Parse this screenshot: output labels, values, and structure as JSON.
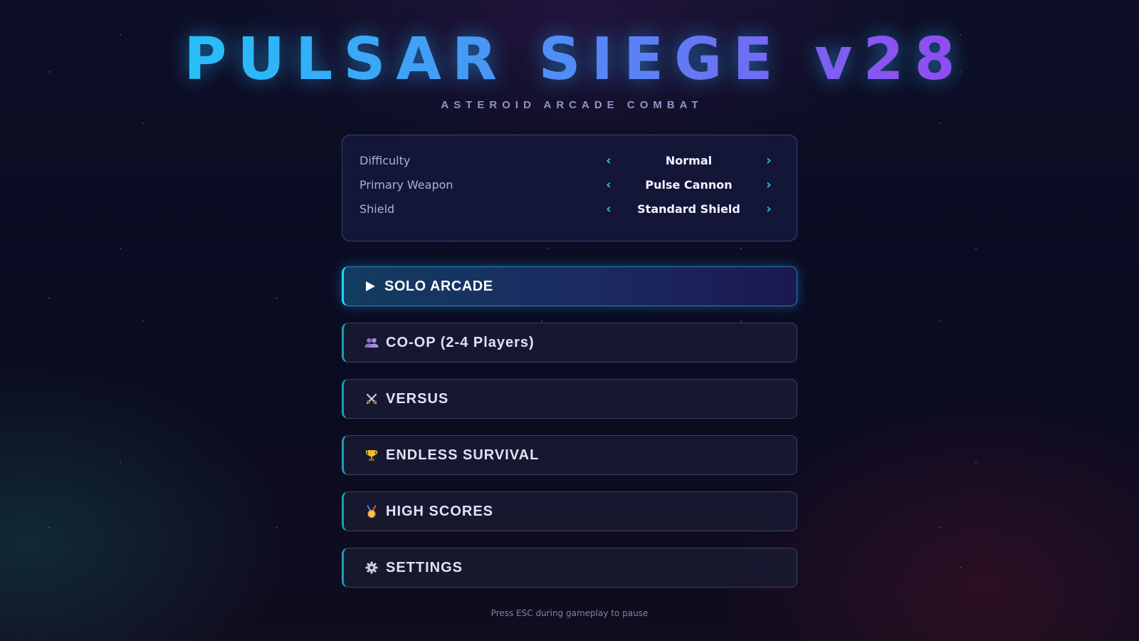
{
  "header": {
    "title": "PULSAR SIEGE v28",
    "subtitle": "ASTEROID ARCADE COMBAT"
  },
  "options": [
    {
      "label": "Difficulty",
      "value": "Normal",
      "prev_icon": "chevron-left-icon",
      "next_icon": "chevron-right-icon"
    },
    {
      "label": "Primary Weapon",
      "value": "Pulse Cannon",
      "prev_icon": "chevron-left-icon",
      "next_icon": "chevron-right-icon"
    },
    {
      "label": "Shield",
      "value": "Standard Shield",
      "prev_icon": "chevron-left-icon",
      "next_icon": "chevron-right-icon"
    }
  ],
  "menu": [
    {
      "label": "SOLO ARCADE",
      "icon": "play-icon",
      "active": true
    },
    {
      "label": "CO-OP (2-4 Players)",
      "icon": "players-icon",
      "active": false
    },
    {
      "label": "VERSUS",
      "icon": "crossed-swords-icon",
      "active": false
    },
    {
      "label": "ENDLESS SURVIVAL",
      "icon": "trophy-icon",
      "active": false
    },
    {
      "label": "HIGH SCORES",
      "icon": "medal-icon",
      "active": false
    },
    {
      "label": "SETTINGS",
      "icon": "gear-icon",
      "active": false
    }
  ],
  "footer": {
    "hint": "Press ESC during gameplay to pause"
  },
  "colors": {
    "accent_cyan": "#22c6f2",
    "accent_purple": "#9c46ee",
    "background": "#0c0e24"
  }
}
